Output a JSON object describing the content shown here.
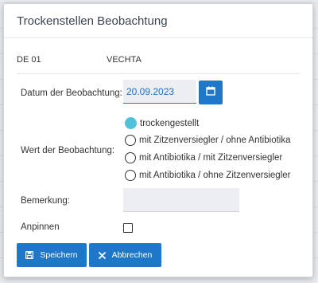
{
  "dialog": {
    "title": "Trockenstellen Beobachtung"
  },
  "animal": {
    "id": "DE 01",
    "name": "VECHTA"
  },
  "form": {
    "date_label": "Datum der Beobachtung:",
    "date_value": "20.09.2023",
    "value_label": "Wert der Beobachtung:",
    "options": [
      {
        "label": "trockengestellt",
        "selected": true
      },
      {
        "label": "mit Zitzenversiegler / ohne Antibiotika",
        "selected": false
      },
      {
        "label": "mit Antibiotika / mit Zitzenversiegler",
        "selected": false
      },
      {
        "label": "mit Antibiotika / ohne Zitzenversiegler",
        "selected": false
      }
    ],
    "remark_label": "Bemerkung:",
    "remark_value": "",
    "pin_label": "Anpinnen",
    "pin_checked": false
  },
  "buttons": {
    "save_label": "Speichern",
    "cancel_label": "Abbrechen"
  },
  "icons": {
    "calendar": "calendar-icon",
    "save": "floppy-disk-icon",
    "cancel": "close-icon"
  },
  "colors": {
    "primary": "#1f77c9",
    "radio_selected": "#4fc1d8"
  }
}
